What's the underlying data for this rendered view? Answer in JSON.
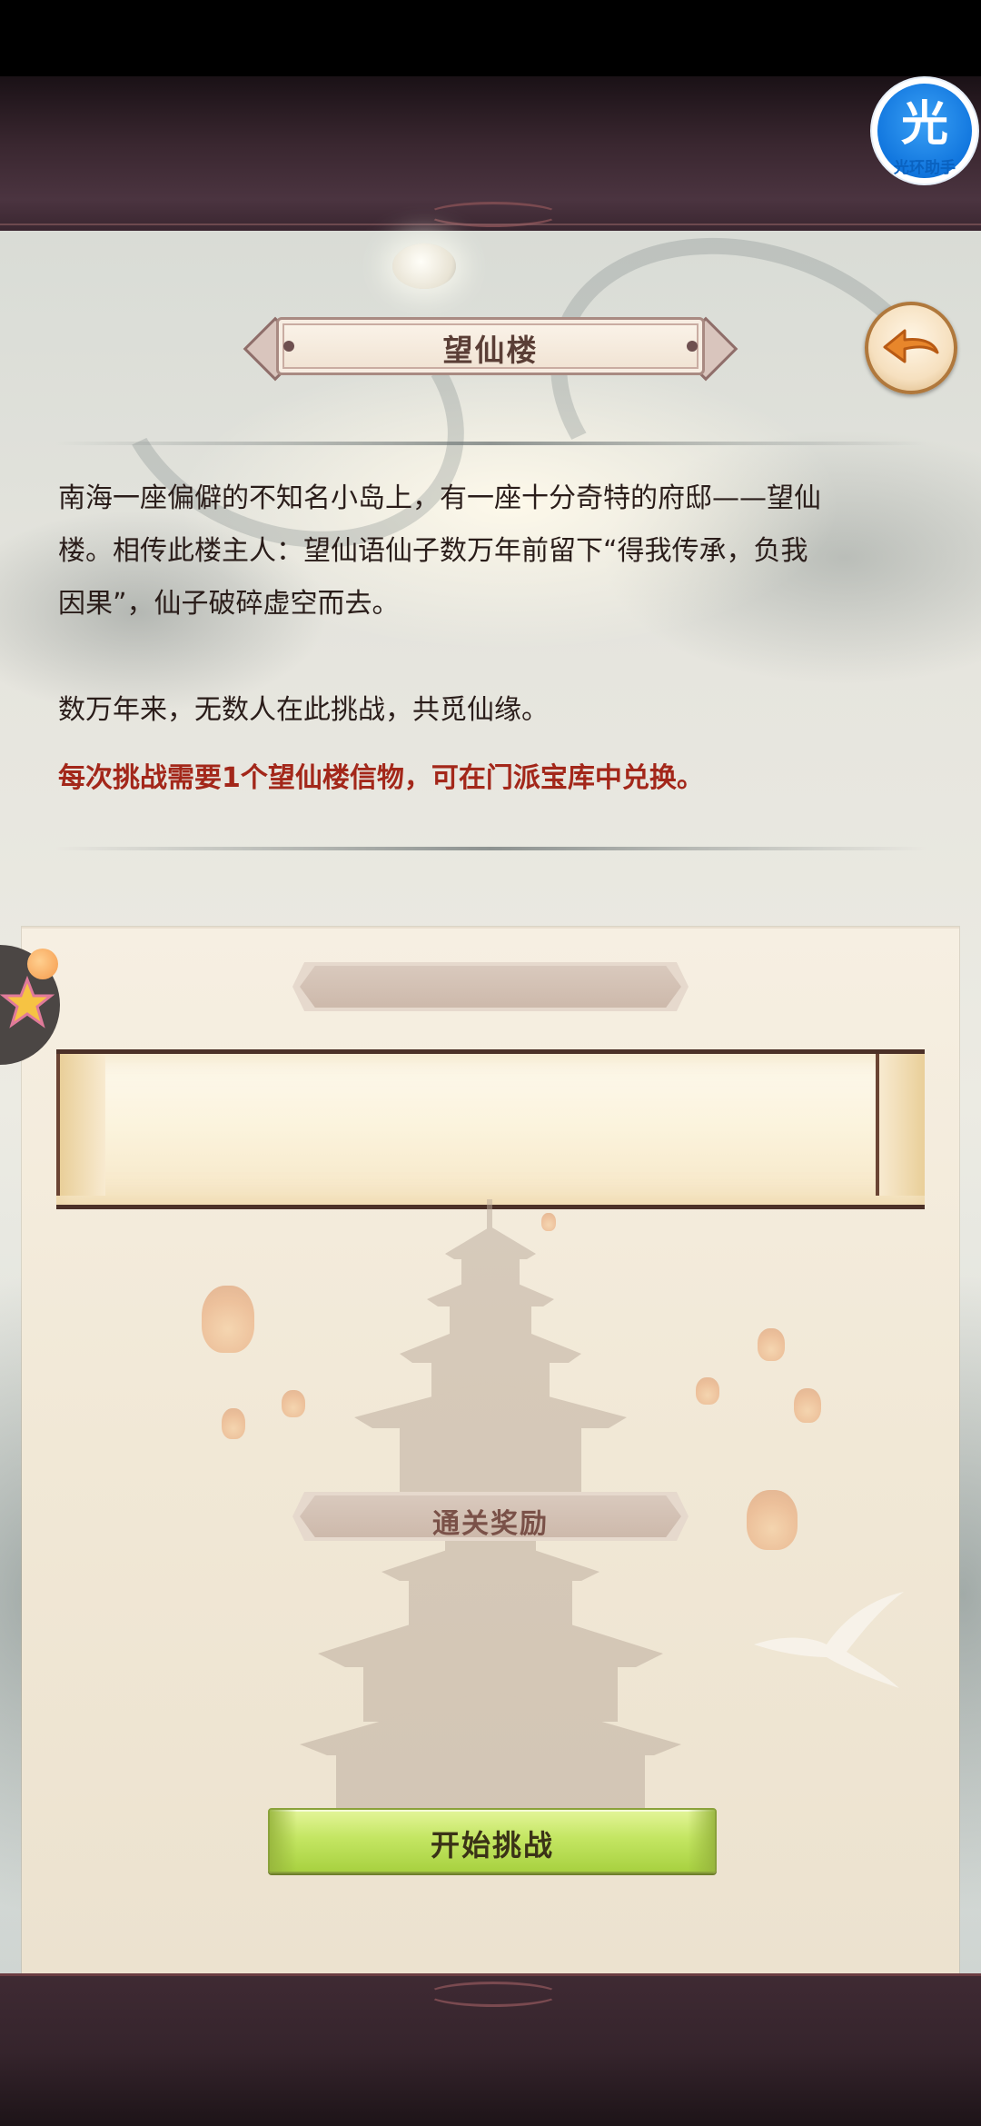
{
  "header": {
    "title": "望仙楼",
    "back_icon": "back-arrow-icon"
  },
  "helper_badge": {
    "glyph": "光",
    "caption": "光环助手"
  },
  "description": {
    "paragraph_1": [
      "南海一座偏僻的不知名小岛上，有一座十分奇特的府邸——望仙",
      "楼。相传此楼主人：望仙语仙子数万年前留下“得我传承，负我",
      "因果”，仙子破碎虚空而去。"
    ],
    "paragraph_2": "数万年来，无数人在此挑战，共觅仙缘。",
    "requirement": "每次挑战需要1个望仙楼信物，可在门派宝库中兑换。"
  },
  "panel": {
    "stage_banner_text": "",
    "reward_title": "通关奖励",
    "start_button_label": "开始挑战"
  },
  "colors": {
    "requirement_text": "#a3271a",
    "start_button": "#c4e663",
    "frame_band": "#3a2730",
    "helper_blue": "#1176de"
  }
}
